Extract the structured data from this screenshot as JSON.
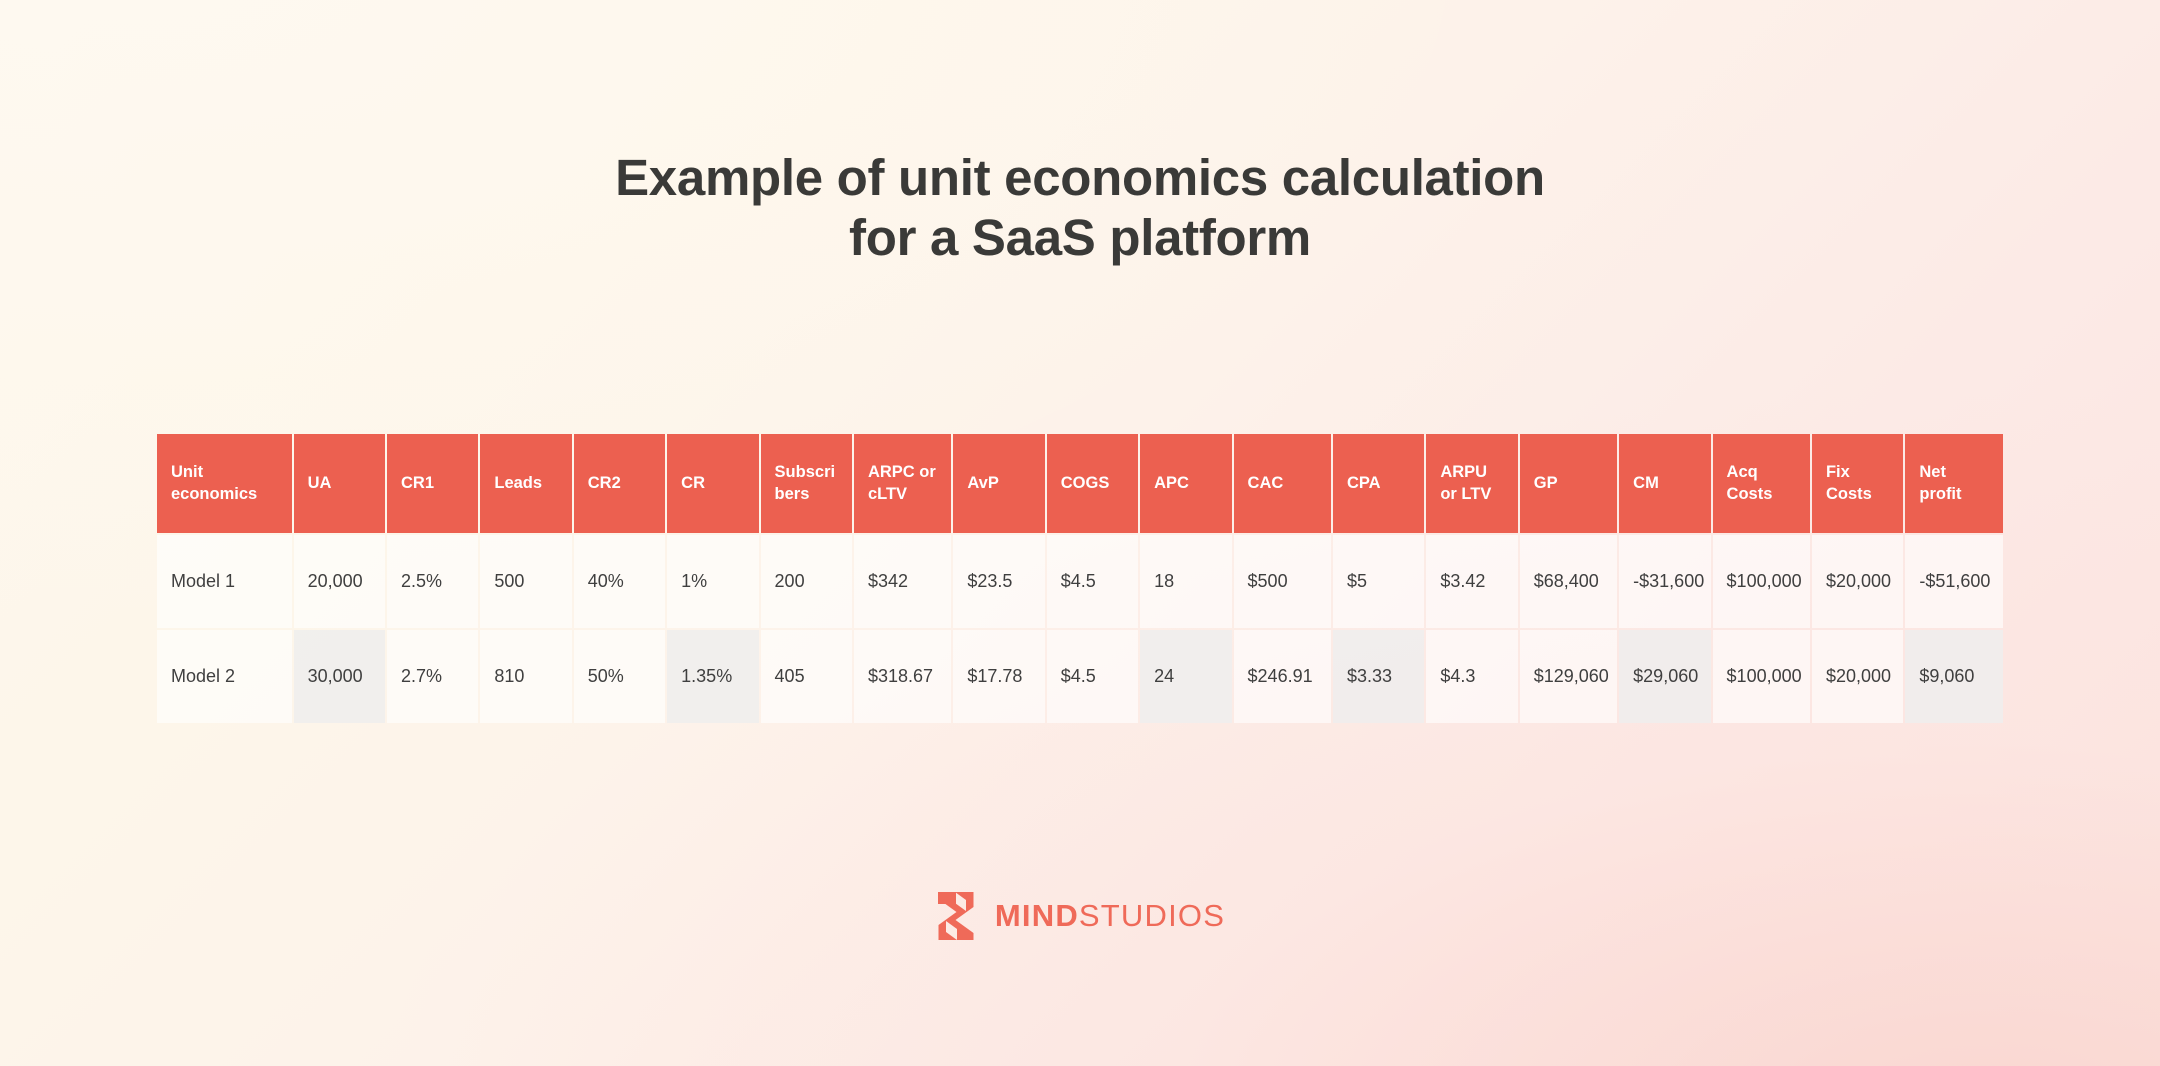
{
  "title": {
    "line1": "Example of unit economics calculation",
    "line2": "for a SaaS platform"
  },
  "brand": {
    "name_part1": "MIND",
    "name_part2": "STUDIOS",
    "logo_icon": "mindstudios-logo-icon",
    "accent_color": "#ec6050",
    "logo_color": "#ef6a59"
  },
  "table": {
    "headers": [
      "Unit economics",
      "UA",
      "CR1",
      "Leads",
      "CR2",
      "CR",
      "Subscri bers",
      "ARPC or cLTV",
      "AvP",
      "COGS",
      "APC",
      "CAC",
      "CPA",
      "ARPU or LTV",
      "GP",
      "CM",
      "Acq Costs",
      "Fix Costs",
      "Net profit"
    ],
    "rows": [
      {
        "label": "Model 1",
        "cells": [
          "20,000",
          "2.5%",
          "500",
          "40%",
          "1%",
          "200",
          "$342",
          "$23.5",
          "$4.5",
          "18",
          "$500",
          "$5",
          "$3.42",
          "$68,400",
          "-$31,600",
          "$100,000",
          "$20,000",
          "-$51,600"
        ],
        "highlight": [
          false,
          false,
          false,
          false,
          false,
          false,
          false,
          false,
          false,
          false,
          false,
          false,
          false,
          false,
          false,
          false,
          false,
          false
        ]
      },
      {
        "label": "Model 2",
        "cells": [
          "30,000",
          "2.7%",
          "810",
          "50%",
          "1.35%",
          "405",
          "$318.67",
          "$17.78",
          "$4.5",
          "24",
          "$246.91",
          "$3.33",
          "$4.3",
          "$129,060",
          "$29,060",
          "$100,000",
          "$20,000",
          "$9,060"
        ],
        "highlight": [
          true,
          false,
          false,
          false,
          true,
          false,
          false,
          false,
          false,
          true,
          false,
          true,
          false,
          false,
          true,
          false,
          false,
          true
        ]
      }
    ]
  }
}
